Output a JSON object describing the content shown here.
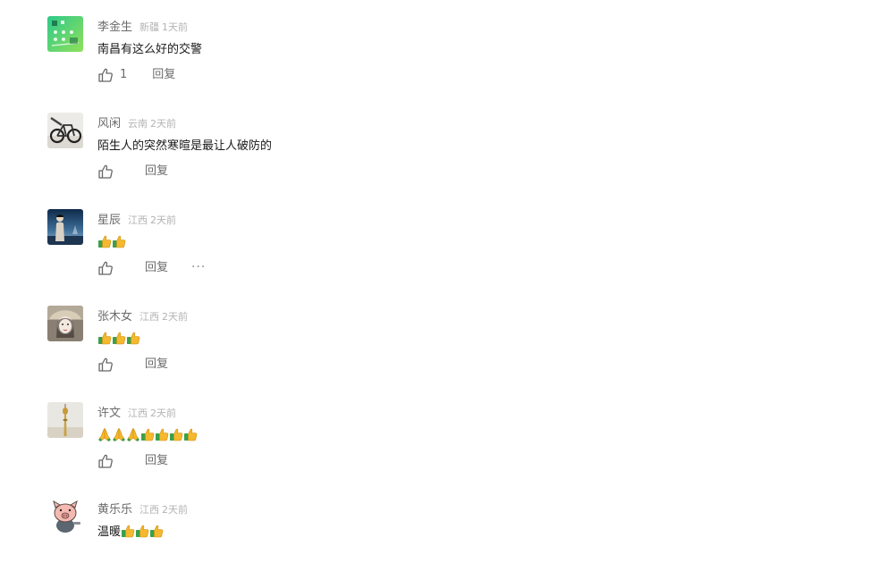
{
  "labels": {
    "reply": "回复",
    "more": "···"
  },
  "comments": [
    {
      "username": "李金生",
      "location": "新疆",
      "time": "1天前",
      "text": "南昌有这么好的交警",
      "likes": "1",
      "avatar_icon": "green-pattern-avatar"
    },
    {
      "username": "风闲",
      "location": "云南",
      "time": "2天前",
      "text": "陌生人的突然寒暄是最让人破防的",
      "likes": "",
      "avatar_icon": "bicycle-avatar"
    },
    {
      "username": "星辰",
      "location": "江西",
      "time": "2天前",
      "text": "",
      "emojis": [
        "thumbs-up-emoji",
        "thumbs-up-emoji"
      ],
      "likes": "",
      "avatar_icon": "person-at-sea-avatar"
    },
    {
      "username": "张木女",
      "location": "江西",
      "time": "2天前",
      "text": "",
      "emojis": [
        "thumbs-up-emoji",
        "thumbs-up-emoji",
        "thumbs-up-emoji"
      ],
      "likes": "",
      "avatar_icon": "portrait-avatar"
    },
    {
      "username": "许文",
      "location": "江西",
      "time": "2天前",
      "text": "",
      "emojis": [
        "praying-hands-emoji",
        "praying-hands-emoji",
        "praying-hands-emoji",
        "thumbs-up-emoji",
        "thumbs-up-emoji",
        "thumbs-up-emoji",
        "thumbs-up-emoji"
      ],
      "likes": "",
      "avatar_icon": "tower-avatar"
    },
    {
      "username": "黄乐乐",
      "location": "江西",
      "time": "2天前",
      "text": "温暖",
      "emojis": [
        "thumbs-up-emoji",
        "thumbs-up-emoji",
        "thumbs-up-emoji"
      ],
      "likes": "",
      "avatar_icon": "cartoon-pig-avatar"
    }
  ],
  "colors": {
    "username": "#6b6b6b",
    "meta": "#b3b3b3",
    "text": "#1a1a1a",
    "thumb_emoji": "#f5b82e",
    "sleeve_emoji": "#3aa04a"
  }
}
